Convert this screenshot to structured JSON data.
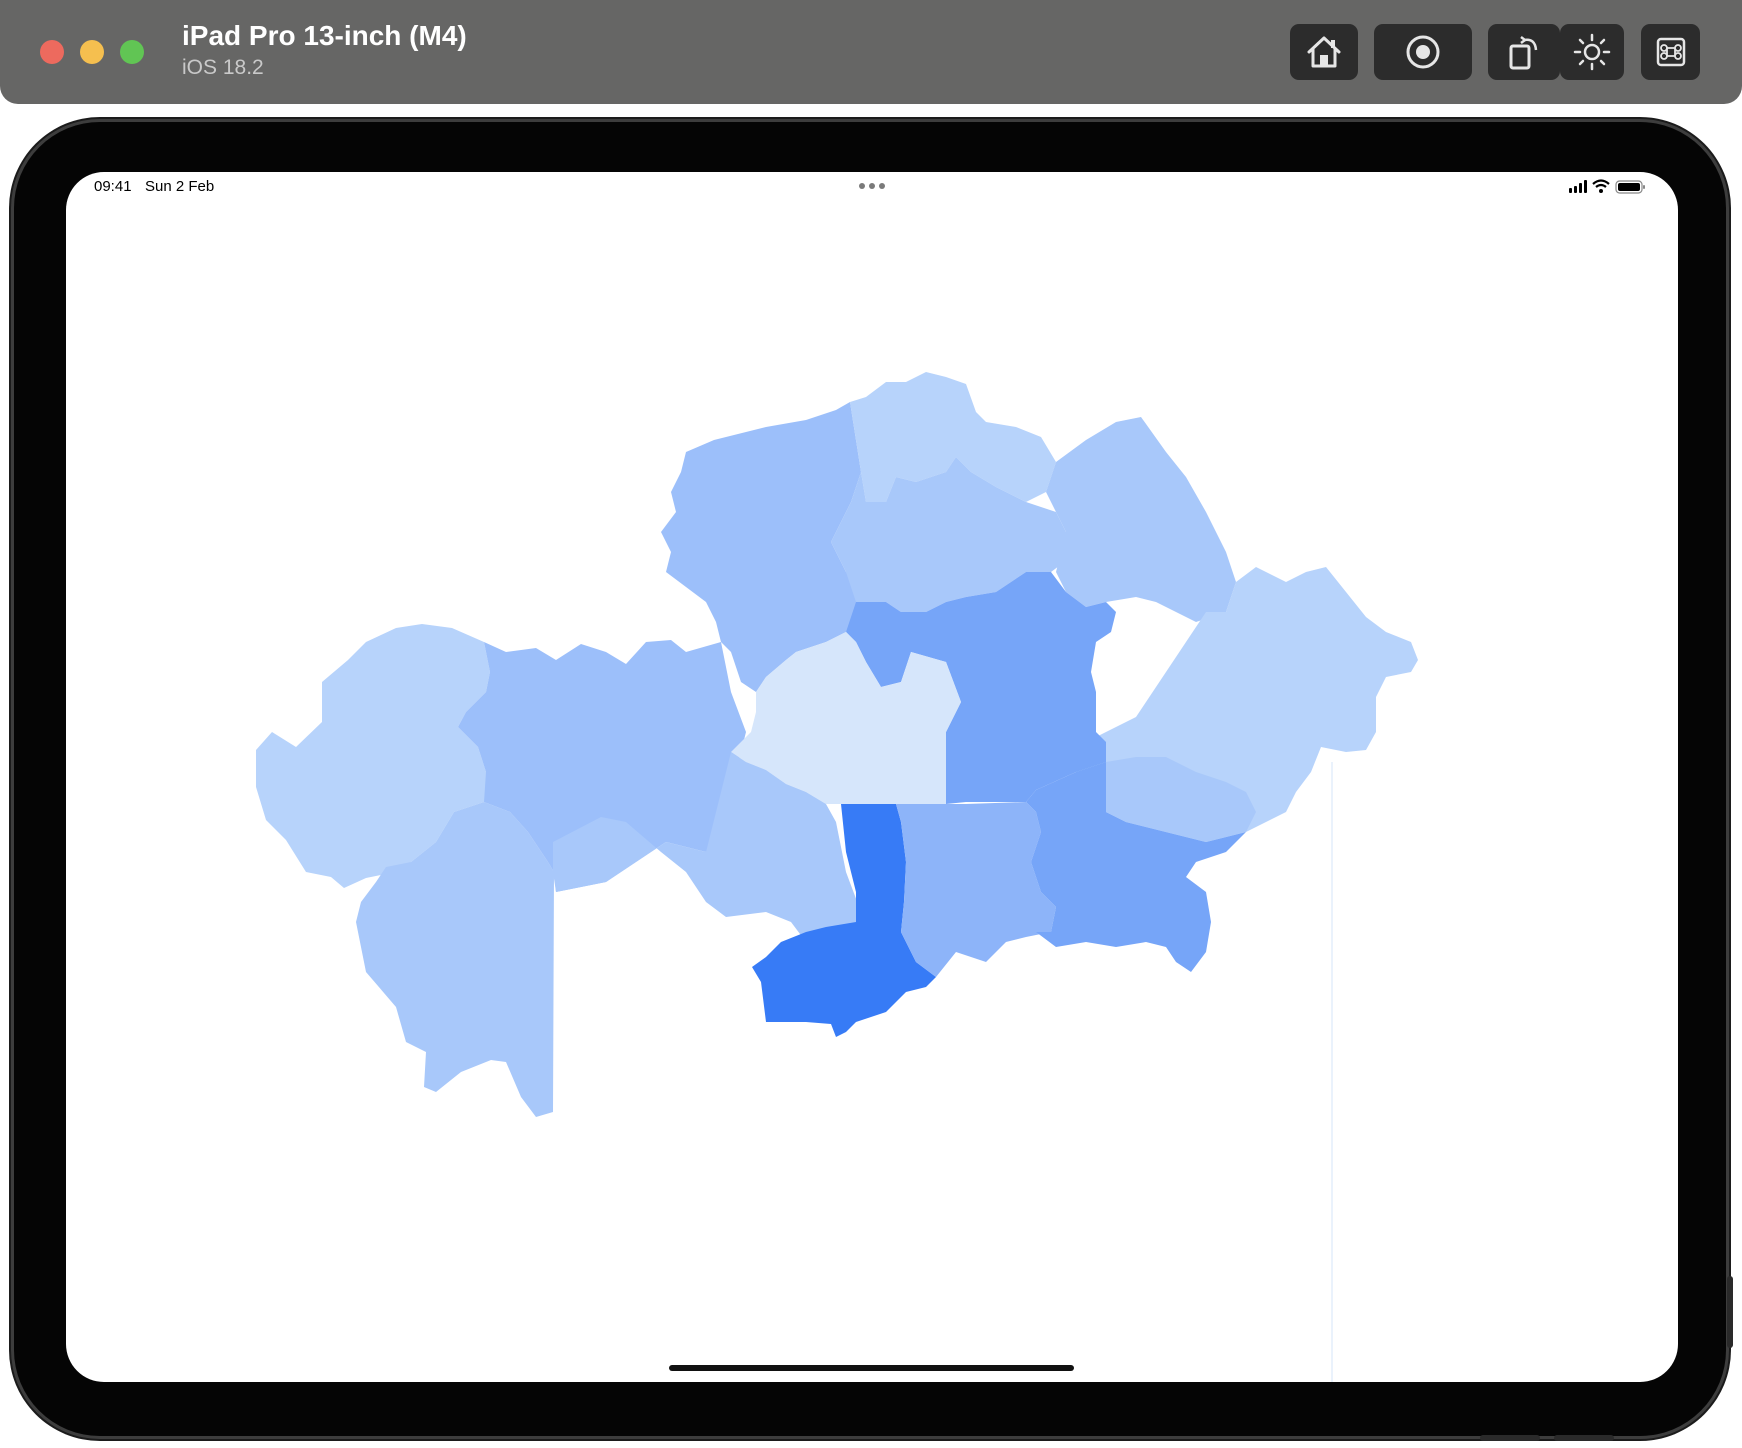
{
  "simulator": {
    "device_name": "iPad Pro 13-inch (M4)",
    "os_version": "iOS 18.2",
    "toolbar_icons": [
      "home-icon",
      "screenshot-icon",
      "rotate-icon",
      "brightness-icon",
      "command-icon"
    ]
  },
  "status_bar": {
    "time": "09:41",
    "date": "Sun 2 Feb",
    "icons": [
      "cellular-signal-icon",
      "wifi-icon",
      "battery-icon"
    ]
  },
  "map": {
    "colors": {
      "lightest": "#d6e6fb",
      "light": "#b7d3fb",
      "light_mid": "#a8c8fa",
      "mid": "#9cbffa",
      "mid_dark": "#8db4f9",
      "dark": "#76a5f8",
      "darkest": "#377bf6"
    }
  }
}
